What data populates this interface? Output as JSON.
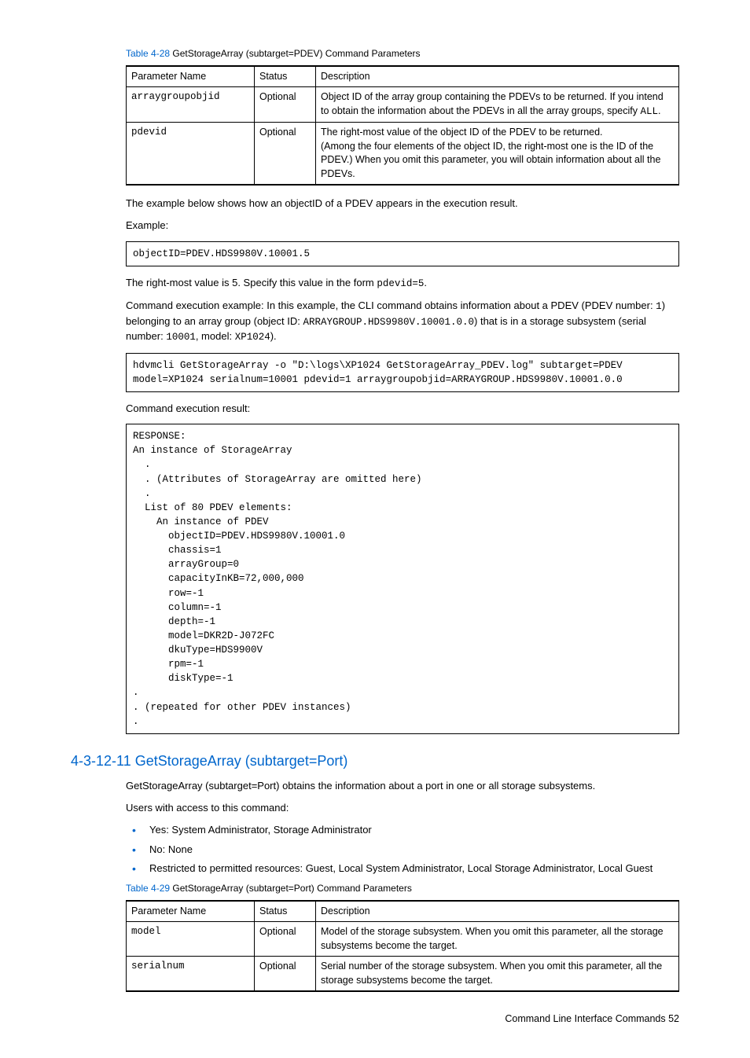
{
  "table28": {
    "caption_num": "Table 4-28",
    "caption_text": "  GetStorageArray (subtarget=PDEV) Command Parameters",
    "headers": [
      "Parameter Name",
      "Status",
      "Description"
    ],
    "rows": [
      {
        "param": "arraygroupobjid",
        "status": "Optional",
        "desc_a": "Object ID of the array group containing the PDEVs to be returned. If you intend to obtain the information about the PDEVs in all the array groups, specify ",
        "desc_code": "ALL",
        "desc_b": "."
      },
      {
        "param": "pdevid",
        "status": "Optional",
        "desc_a": "The right-most value of the object ID of the PDEV to be returned.\n(Among the four elements of the object ID, the right-most one is the ID of the PDEV.) When you omit this parameter, you will obtain information about all the PDEVs.",
        "desc_code": "",
        "desc_b": ""
      }
    ]
  },
  "para_example_intro": "The example below shows how an objectID of a PDEV appears in the execution result.",
  "label_example": "Example:",
  "code_objectid": "objectID=PDEV.HDS9980V.10001.5",
  "para_rightmost_a": "The right-most value is 5. Specify this value in the form ",
  "para_rightmost_code": "pdevid=5",
  "para_rightmost_b": ".",
  "para_cmdexec": {
    "a": "Command execution example: In this example, the CLI command obtains information about a PDEV (PDEV number: ",
    "c1": "1",
    "b": ") belonging to an array group (object ID: ",
    "c2": "ARRAYGROUP.HDS9980V.10001.0.0",
    "c": ") that is in a storage subsystem (serial number: ",
    "c3": "10001",
    "d": ", model: ",
    "c4": "XP1024",
    "e": ")."
  },
  "code_cmd": "hdvmcli GetStorageArray -o \"D:\\logs\\XP1024 GetStorageArray_PDEV.log\" subtarget=PDEV model=XP1024 serialnum=10001 pdevid=1 arraygroupobjid=ARRAYGROUP.HDS9980V.10001.0.0",
  "label_cmd_result": "Command execution result:",
  "code_result": "RESPONSE:\nAn instance of StorageArray\n  .\n  . (Attributes of StorageArray are omitted here)\n  .\n  List of 80 PDEV elements:\n    An instance of PDEV\n      objectID=PDEV.HDS9980V.10001.0\n      chassis=1\n      arrayGroup=0\n      capacityInKB=72,000,000\n      row=-1\n      column=-1\n      depth=-1\n      model=DKR2D-J072FC\n      dkuType=HDS9900V\n      rpm=-1\n      diskType=-1\n.\n. (repeated for other PDEV instances)\n.",
  "section_heading": "4-3-12-11 GetStorageArray (subtarget=Port)",
  "para_port_intro": "GetStorageArray (subtarget=Port) obtains the information about a port in one or all storage subsystems.",
  "label_users_access": "Users with access to this command:",
  "bullets": [
    "Yes: System Administrator, Storage Administrator",
    "No: None",
    "Restricted to permitted resources: Guest, Local System Administrator, Local Storage Administrator, Local Guest"
  ],
  "table29": {
    "caption_num": "Table 4-29",
    "caption_text": "  GetStorageArray (subtarget=Port) Command Parameters",
    "headers": [
      "Parameter Name",
      "Status",
      "Description"
    ],
    "rows": [
      {
        "param": "model",
        "status": "Optional",
        "desc": "Model of the storage subsystem. When you omit this parameter, all the storage subsystems become the target."
      },
      {
        "param": "serialnum",
        "status": "Optional",
        "desc": "Serial number of the storage subsystem. When you omit this parameter, all the storage subsystems become the target."
      }
    ]
  },
  "footer": "Command Line Interface Commands   52"
}
